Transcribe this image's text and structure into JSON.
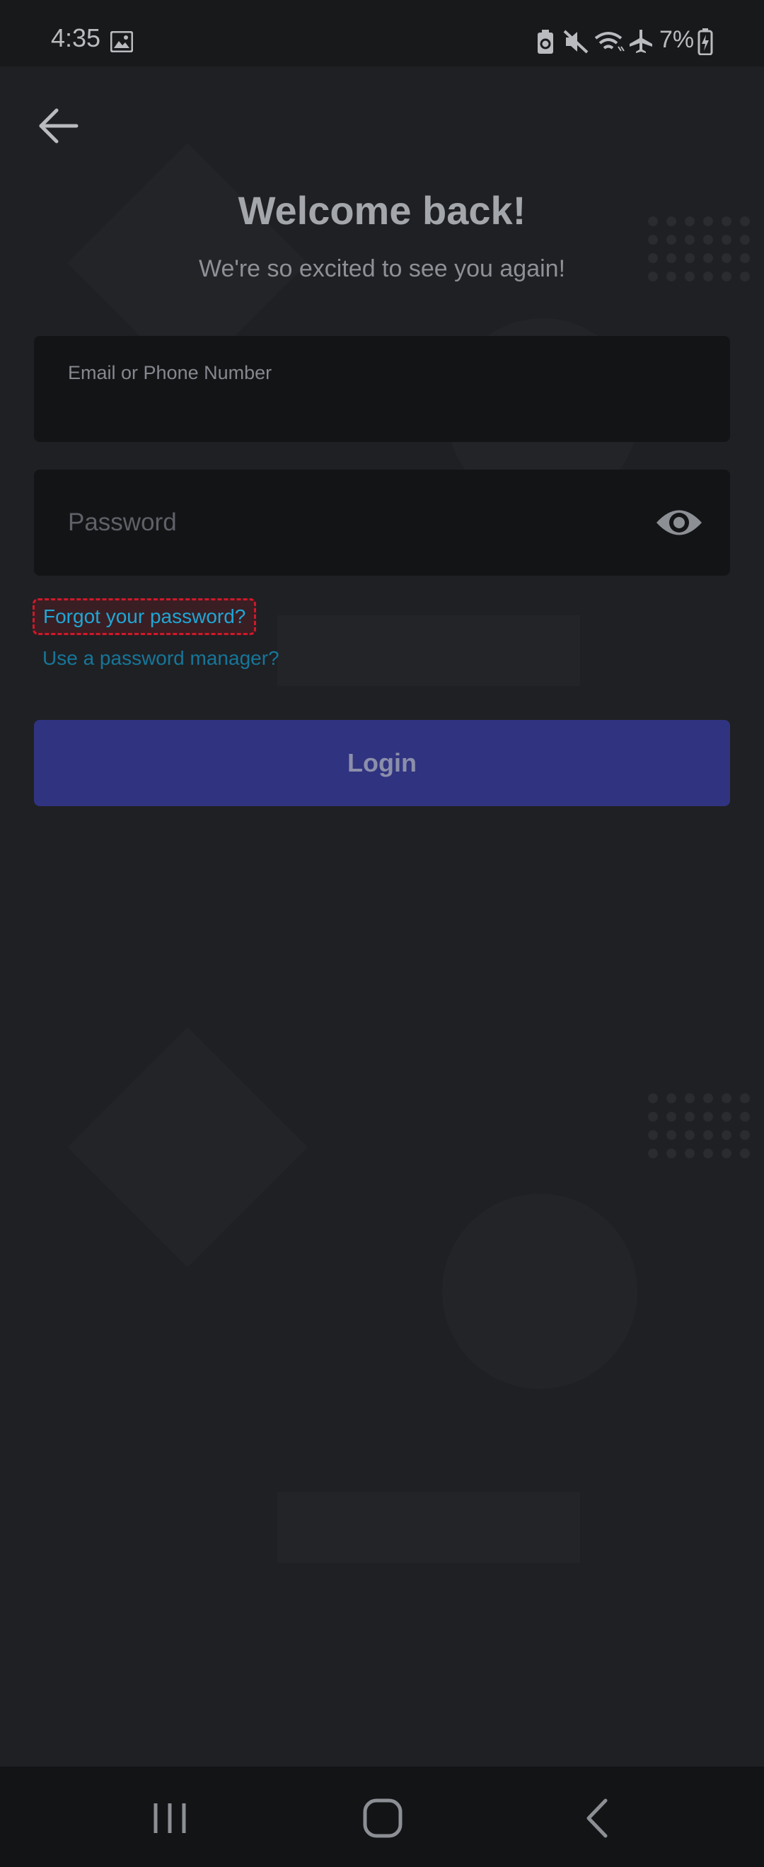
{
  "status_bar": {
    "time": "4:35",
    "battery": "7%",
    "icons": [
      "gallery-icon",
      "battery-saver-icon",
      "mute-icon",
      "wifi-icon",
      "airplane-mode-icon",
      "battery-charging-icon"
    ]
  },
  "header": {
    "back_icon": "arrow-left-icon"
  },
  "main": {
    "title": "Welcome back!",
    "subtitle": "We're so excited to see you again!",
    "email_label": "Email or Phone Number",
    "password_placeholder": "Password",
    "eye_icon": "eye-icon",
    "forgot_password": "Forgot your password?",
    "password_manager": "Use a password manager?",
    "login_label": "Login"
  },
  "nav_bar": {
    "icons": [
      "recent-apps-icon",
      "home-icon",
      "back-icon"
    ]
  },
  "colors": {
    "background": "#1f2023",
    "input_background": "#131416",
    "login_button": "#30337f",
    "link": "#1fa7d6",
    "highlight_border": "#d0192a"
  }
}
